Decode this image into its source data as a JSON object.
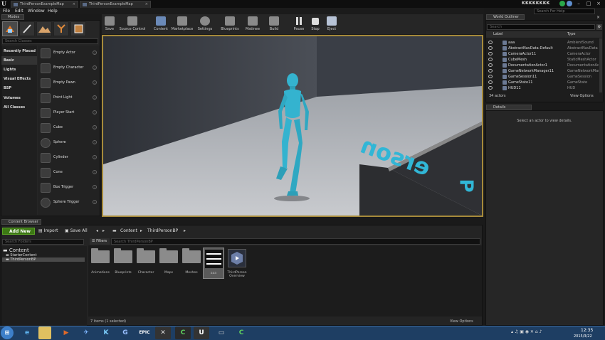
{
  "window": {
    "tabs": [
      {
        "label": "ThirdPersonExampleMap"
      },
      {
        "label": "ThirdPersonExampleMap"
      }
    ],
    "user": "KKKKKKKK",
    "help_search_placeholder": "Search For Help"
  },
  "menu": [
    "File",
    "Edit",
    "Window",
    "Help"
  ],
  "modes": {
    "tab_label": "Modes",
    "search_placeholder": "Search Classes",
    "categories": [
      "Recently Placed",
      "Basic",
      "Lights",
      "Visual Effects",
      "BSP",
      "Volumes",
      "All Classes"
    ],
    "items": [
      "Empty Actor",
      "Empty Character",
      "Empty Pawn",
      "Point Light",
      "Player Start",
      "Cube",
      "Sphere",
      "Cylinder",
      "Cone",
      "Box Trigger",
      "Sphere Trigger"
    ]
  },
  "toolbar": {
    "buttons": [
      "Save",
      "Source Control",
      "Content",
      "Marketplace",
      "Settings",
      "Blueprints",
      "Matinee",
      "Build",
      "Pause",
      "Stop",
      "Eject"
    ]
  },
  "viewport": {
    "floor_text": "erson",
    "wall_letter": "P"
  },
  "outliner": {
    "tab_label": "World Outliner",
    "search_placeholder": "Search",
    "col_label": "Label",
    "col_type": "Type",
    "rows": [
      {
        "label": "aaa",
        "type": "AmbientSound"
      },
      {
        "label": "AbstractNavData-Default",
        "type": "AbstractNavData"
      },
      {
        "label": "CameraActor11",
        "type": "CameraActor"
      },
      {
        "label": "CubeMesh",
        "type": "StaticMeshActor"
      },
      {
        "label": "DocumentationActor1",
        "type": "DocumentationAc"
      },
      {
        "label": "GameNetworkManager11",
        "type": "GameNetworkMar"
      },
      {
        "label": "GameSession11",
        "type": "GameSession"
      },
      {
        "label": "GameState11",
        "type": "GameState"
      },
      {
        "label": "HUD11",
        "type": "HUD"
      }
    ],
    "actor_count": "34 actors",
    "view_options": "View Options"
  },
  "details": {
    "tab_label": "Details",
    "empty_text": "Select an actor to view details."
  },
  "content_browser": {
    "tab_label": "Content Browser",
    "add_new": "Add New",
    "import": "Import",
    "save_all": "Save All",
    "path": [
      "Content",
      "ThirdPersonBP"
    ],
    "search_folders_placeholder": "Search Folders",
    "tree": [
      "Content",
      "StarterContent",
      "ThirdPersonBP"
    ],
    "filters": "Filters",
    "search_path_placeholder": "Search ThirdPersonBP",
    "assets": [
      {
        "label": "Animations",
        "kind": "folder"
      },
      {
        "label": "Blueprints",
        "kind": "folder"
      },
      {
        "label": "Character",
        "kind": "folder"
      },
      {
        "label": "Maps",
        "kind": "folder"
      },
      {
        "label": "Meshes",
        "kind": "folder"
      },
      {
        "label": "aaa",
        "kind": "asset"
      },
      {
        "label": "ThirdPerson Overview",
        "kind": "asset"
      }
    ],
    "status": "7 items (1 selected)",
    "view_options": "View Options"
  },
  "taskbar": {
    "time": "12:35",
    "date": "2015/3/22"
  },
  "colors": {
    "accent_green": "#3d7a14",
    "viewport_border": "#a68a3a",
    "mannequin": "#34b3cf",
    "taskbar": "#1e3e63"
  }
}
